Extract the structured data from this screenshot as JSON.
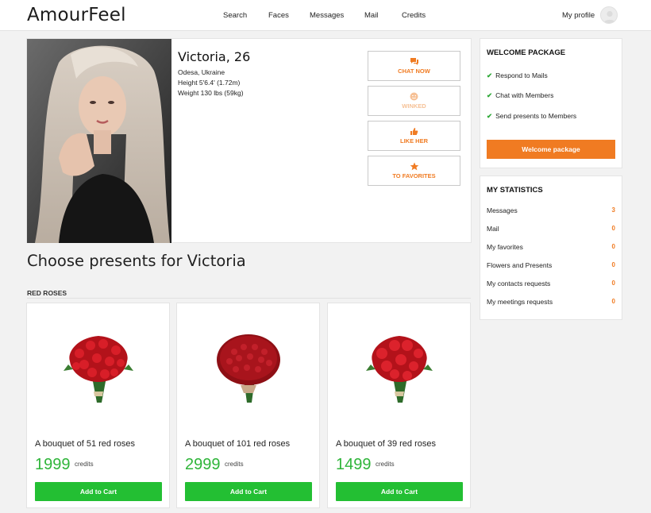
{
  "header": {
    "logo": "AmourFeel",
    "nav": [
      "Search",
      "Faces",
      "Messages",
      "Mail",
      "Credits"
    ],
    "profile_label": "My profile"
  },
  "profile": {
    "name_age": "Victoria, 26",
    "location": "Odesa, Ukraine",
    "height": "Height 5'6.4' (1.72m)",
    "weight": "Weight 130 lbs (59kg)",
    "actions": [
      {
        "label": "CHAT NOW",
        "icon": "chat-icon",
        "enabled": true
      },
      {
        "label": "WINKED",
        "icon": "wink-icon",
        "enabled": false
      },
      {
        "label": "LIKE HER",
        "icon": "thumbs-up-icon",
        "enabled": true
      },
      {
        "label": "TO FAVORITES",
        "icon": "star-icon",
        "enabled": true
      }
    ]
  },
  "welcome_package": {
    "title": "WELCOME PACKAGE",
    "items": [
      "Respond to Mails",
      "Chat with Members",
      "Send presents to Members"
    ],
    "button_label": "Welcome package"
  },
  "statistics": {
    "title": "MY STATISTICS",
    "rows": [
      {
        "label": "Messages",
        "value": "3"
      },
      {
        "label": "Mail",
        "value": "0"
      },
      {
        "label": "My favorites",
        "value": "0"
      },
      {
        "label": "Flowers and Presents",
        "value": "0"
      },
      {
        "label": "My contacts requests",
        "value": "0"
      },
      {
        "label": "My meetings requests",
        "value": "0"
      }
    ]
  },
  "presents": {
    "title": "Choose presents for Victoria",
    "category": "RED ROSES",
    "items": [
      {
        "name": "A bouquet of 51 red roses",
        "price": "1999",
        "unit": "credits",
        "button": "Add to Cart"
      },
      {
        "name": "A bouquet of 101 red roses",
        "price": "2999",
        "unit": "credits",
        "button": "Add to Cart"
      },
      {
        "name": "A bouquet of 39 red roses",
        "price": "1499",
        "unit": "credits",
        "button": "Add to Cart"
      }
    ]
  },
  "colors": {
    "accent_orange": "#f07b22",
    "price_green": "#2fb53a",
    "cart_green": "#23bf33",
    "check_green": "#2fa938"
  }
}
